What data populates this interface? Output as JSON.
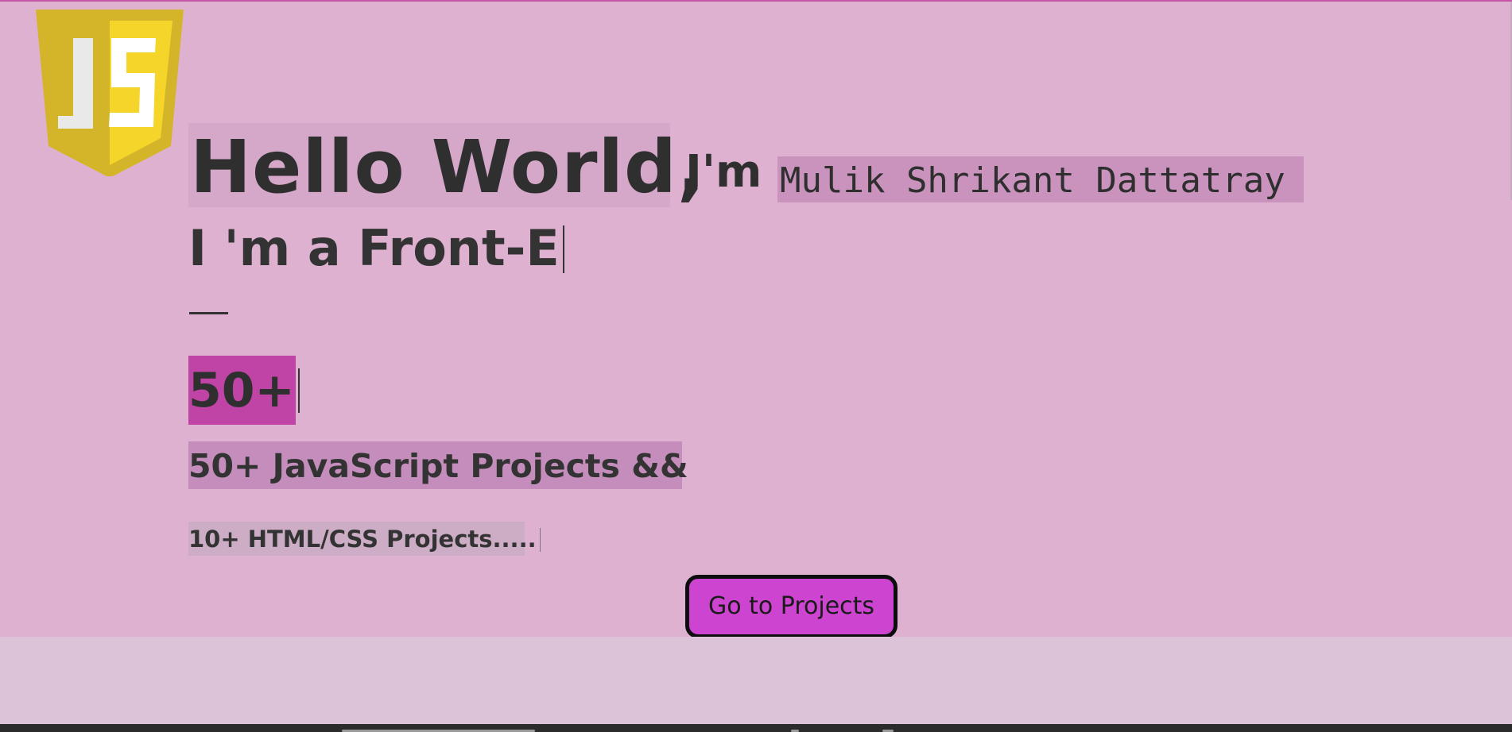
{
  "logo": {
    "text": "JS",
    "shield_left_color": "#d4b52a",
    "shield_right_color": "#f6d52a",
    "letter_left_color": "#e9e9e9",
    "letter_right_color": "#ffffff"
  },
  "hero": {
    "greeting": "Hello World,",
    "intro": "I'm",
    "name": "Mulik Shrikant Dattatray",
    "typed_role": "I 'm a Front-E",
    "counter": "50+",
    "js_projects": "50+ JavaScript Projects &&",
    "html_projects": "10+ HTML/CSS Projects.....",
    "button_label": "Go to Projects"
  },
  "colors": {
    "hero_background": "#deb1d1",
    "accent": "#cc44cf",
    "counter_highlight": "#c044a6",
    "text": "#333333"
  }
}
